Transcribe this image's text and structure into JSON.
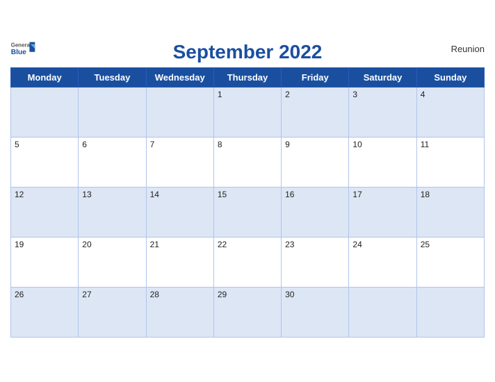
{
  "header": {
    "title": "September 2022",
    "region": "Reunion",
    "logo": {
      "general": "General",
      "blue": "Blue"
    }
  },
  "weekdays": [
    "Monday",
    "Tuesday",
    "Wednesday",
    "Thursday",
    "Friday",
    "Saturday",
    "Sunday"
  ],
  "weeks": [
    [
      null,
      null,
      null,
      1,
      2,
      3,
      4
    ],
    [
      5,
      6,
      7,
      8,
      9,
      10,
      11
    ],
    [
      12,
      13,
      14,
      15,
      16,
      17,
      18
    ],
    [
      19,
      20,
      21,
      22,
      23,
      24,
      25
    ],
    [
      26,
      27,
      28,
      29,
      30,
      null,
      null
    ]
  ]
}
